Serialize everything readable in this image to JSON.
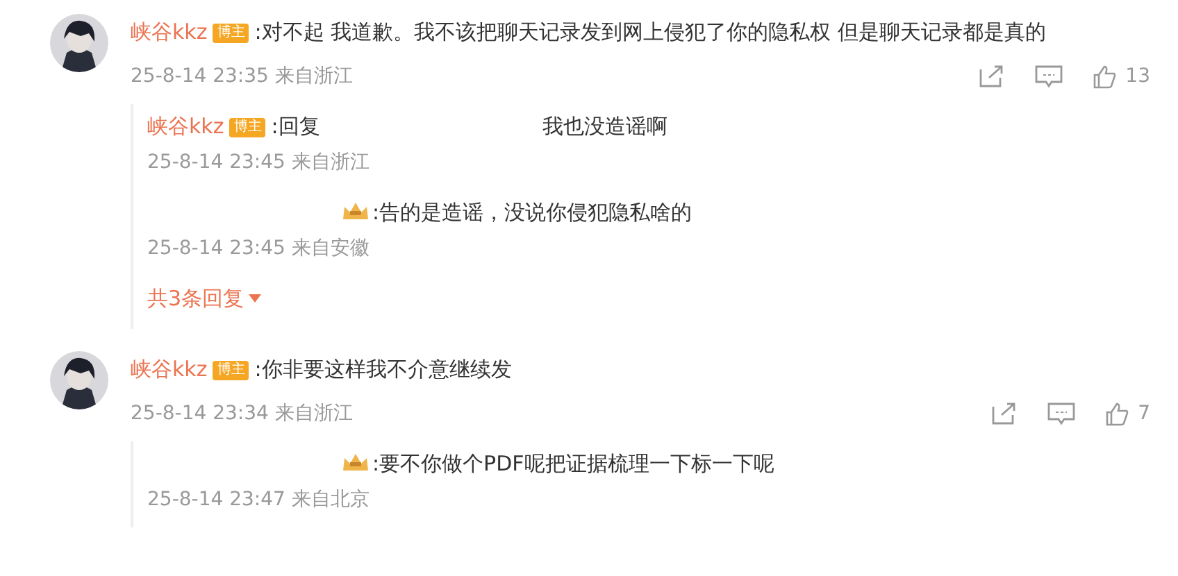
{
  "comments": [
    {
      "author": "峡谷kkz",
      "badge": "博主",
      "text": ":对不起 我道歉。我不该把聊天记录发到网上侵犯了你的隐私权 但是聊天记录都是真的",
      "time": "25-8-14 23:35 来自浙江",
      "likes": "13",
      "replies": [
        {
          "author": "峡谷kkz",
          "badge": "博主",
          "author_hidden": false,
          "text": ":回复",
          "mention_hidden": true,
          "content": "我也没造谣啊",
          "time": "25-8-14 23:45 来自浙江"
        },
        {
          "author_hidden": true,
          "text": ":告的是造谣，没说你侵犯隐私啥的",
          "time": "25-8-14 23:45 来自安徽"
        }
      ],
      "more": "共3条回复"
    },
    {
      "author": "峡谷kkz",
      "badge": "博主",
      "text": ":你非要这样我不介意继续发",
      "time": "25-8-14 23:34 来自浙江",
      "likes": "7",
      "replies": [
        {
          "author_hidden": true,
          "text": ":要不你做个PDF呢把证据梳理一下标一下呢",
          "time": "25-8-14 23:47 来自北京"
        }
      ]
    }
  ]
}
